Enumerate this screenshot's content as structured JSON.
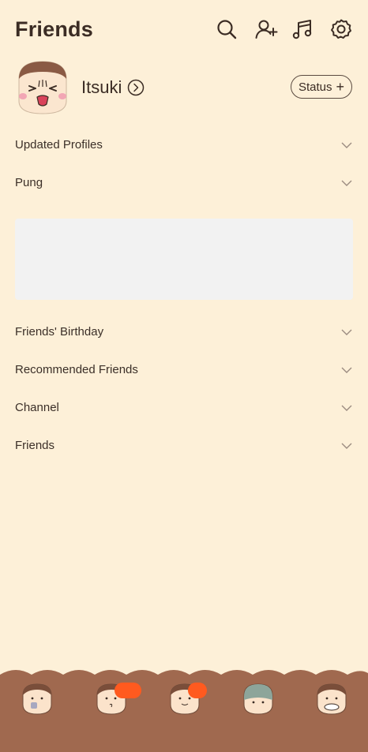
{
  "header": {
    "title": "Friends",
    "icons": [
      "search-icon",
      "add-friend-icon",
      "music-icon",
      "settings-icon"
    ]
  },
  "profile": {
    "name": "Itsuki",
    "status_label": "Status",
    "status_plus": "+"
  },
  "sections": [
    {
      "label": "Updated Profiles"
    },
    {
      "label": "Pung"
    },
    {
      "label": "Friends' Birthday"
    },
    {
      "label": "Recommended Friends"
    },
    {
      "label": "Channel"
    },
    {
      "label": "Friends"
    }
  ],
  "colors": {
    "background": "#fdf0d8",
    "tabbar": "#a0694f",
    "badge": "#ff5a1f",
    "banner": "#f2f2f2"
  },
  "tabbar": {
    "tabs": [
      "friends-tab",
      "chats-tab",
      "openchat-tab",
      "shopping-tab",
      "more-tab"
    ]
  }
}
